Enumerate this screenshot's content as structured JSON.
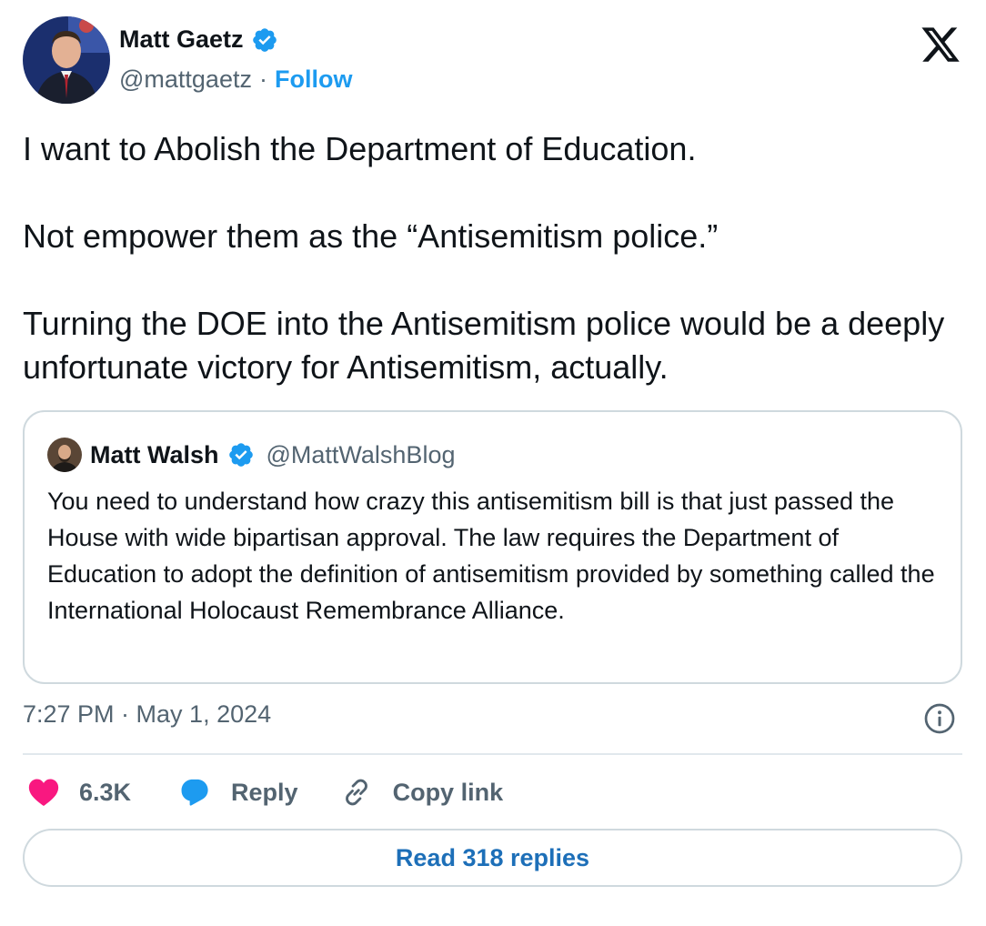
{
  "author": {
    "name": "Matt Gaetz",
    "handle": "@mattgaetz",
    "separator": "·",
    "follow_label": "Follow"
  },
  "tweet": {
    "paragraphs": [
      "I want to Abolish the Department of Education.",
      "Not empower them as the “Antisemitism police.”",
      "Turning the DOE into the Antisemitism police would be a deeply unfortunate victory for Antisemitism, actually."
    ],
    "timestamp": "7:27 PM · May 1, 2024"
  },
  "quoted_tweet": {
    "name": "Matt Walsh",
    "handle": "@MattWalshBlog",
    "text": "You need to understand how crazy this antisemitism bill is that just passed the House with wide bipartisan approval. The law requires the Department of Education to adopt the definition of antisemitism provided by something called the International Holocaust Remembrance Alliance."
  },
  "actions": {
    "likes": "6.3K",
    "reply_label": "Reply",
    "copy_link_label": "Copy link"
  },
  "read_replies_label": "Read 318 replies",
  "colors": {
    "accent_blue": "#1d9bf0",
    "like_pink": "#f91880",
    "secondary_text": "#536471",
    "border": "#cfd9de"
  },
  "icons": [
    "verified-badge-icon",
    "x-logo-icon",
    "info-icon",
    "heart-icon",
    "reply-bubble-icon",
    "link-icon"
  ]
}
